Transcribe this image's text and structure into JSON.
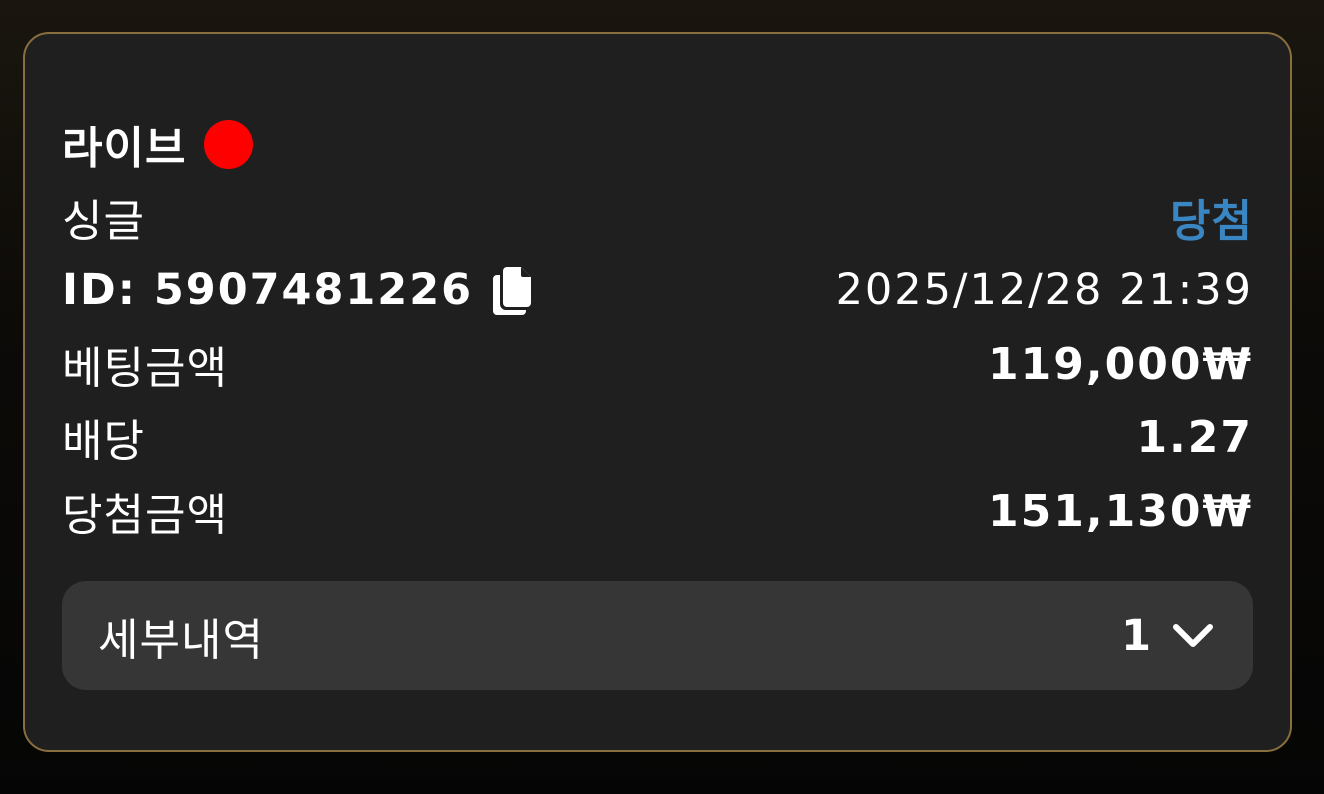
{
  "card": {
    "title": "라이브",
    "live_indicator_color": "#ff0000",
    "bet_type": "싱글",
    "result": "당첨",
    "result_color": "#3a86c2",
    "id_text": "ID: 5907481226",
    "datetime": "2025/12/28 21:39",
    "rows": {
      "bet_amount": {
        "label": "베팅금액",
        "value": "119,000₩"
      },
      "odds": {
        "label": "배당",
        "value": "1.27"
      },
      "win_amount": {
        "label": "당첨금액",
        "value": "151,130₩"
      }
    },
    "details": {
      "label": "세부내역",
      "count": "1",
      "icon": "chevron-down-icon"
    },
    "icons": {
      "copy": "copy-icon"
    },
    "border_color": "#8a6f3e",
    "background_color": "#1f1f1f"
  }
}
